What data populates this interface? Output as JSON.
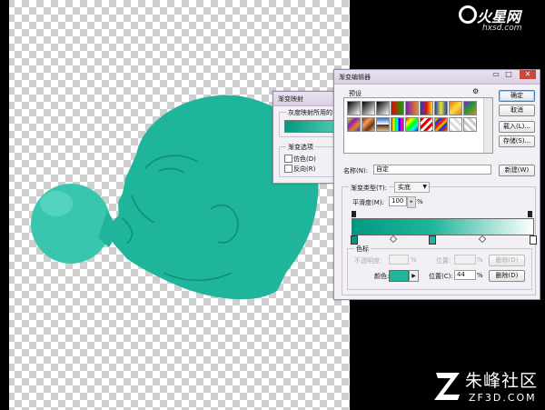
{
  "watermarks": {
    "top_brand": "火星网",
    "top_url": "hxsd.com",
    "bottom_brand": "朱峰社区",
    "bottom_url": "ZF3D.COM"
  },
  "colors": {
    "teal_fill": "#1fb59a",
    "gradient_start": "#009a80",
    "gradient_end": "#ffffff"
  },
  "gradient_map_dialog": {
    "title": "渐变映射",
    "group_label": "灰度映射所用的",
    "options_label": "渐变选项",
    "dither_label": "仿色(D)",
    "reverse_label": "反向(R)"
  },
  "gradient_editor": {
    "title": "渐变编辑器",
    "presets_label": "预设",
    "ok": "确定",
    "cancel": "取消",
    "load": "载入(L)...",
    "save": "存储(S)...",
    "name_label": "名称(N):",
    "name_value": "自定",
    "new_button": "新建(W)",
    "gradient_type_label": "渐变类型(T):",
    "gradient_type_value": "实底",
    "smoothness_label": "平滑度(M):",
    "smoothness_value": "100",
    "percent": "%",
    "stops_label": "色标",
    "opacity_label": "不透明度:",
    "location_label": "位置:",
    "delete_label": "删除(D)",
    "color_label": "颜色:",
    "color_location_label": "位置(C):",
    "color_location_value": "44",
    "color_swatch": "#1fb59a",
    "gradient_stop_position": 0.44,
    "presets": [
      {
        "icon": "preset-fg-bg",
        "bg": "linear-gradient(135deg,#000,#fff)"
      },
      {
        "icon": "preset-fg-transparent",
        "bg": "linear-gradient(135deg,#000,rgba(0,0,0,0))"
      },
      {
        "icon": "preset-black-white",
        "bg": "linear-gradient(135deg,#000,#fff)"
      },
      {
        "icon": "preset-red-green",
        "bg": "linear-gradient(90deg,#e00,#0a0)"
      },
      {
        "icon": "preset-violet-orange",
        "bg": "linear-gradient(90deg,#7a1fb0,#f08a1a)"
      },
      {
        "icon": "preset-blue-red-yellow",
        "bg": "linear-gradient(90deg,#1a3fd0,#e01010,#f5e020)"
      },
      {
        "icon": "preset-blue-yellow-blue",
        "bg": "linear-gradient(90deg,#1040d0,#f4e020,#1040d0)"
      },
      {
        "icon": "preset-orange-yellow-orange",
        "bg": "linear-gradient(135deg,#f07010,#f8e040,#f07010)"
      },
      {
        "icon": "preset-violet-green-orange",
        "bg": "linear-gradient(135deg,#8020c0,#20a030,#f08020)"
      },
      {
        "icon": "preset-yellow-violet-orange-blue",
        "bg": "linear-gradient(135deg,#f0e020,#8020c0,#f08020,#2040d0)"
      },
      {
        "icon": "preset-copper",
        "bg": "linear-gradient(135deg,#703010,#f0a060,#703010,#f0c080)"
      },
      {
        "icon": "preset-chrome",
        "bg": "linear-gradient(180deg,#2a6fd0,#fff 48%,#4a3010 52%,#e0c090)"
      },
      {
        "icon": "preset-spectrum",
        "bg": "linear-gradient(90deg,#f00,#ff0,#0f0,#0ff,#00f,#f0f,#f00)"
      },
      {
        "icon": "preset-transparent-rainbow",
        "bg": "linear-gradient(135deg,#f00,#ff0,#0f0,#0ff,#00f)"
      },
      {
        "icon": "preset-transparent-stripes",
        "bg": "repeating-linear-gradient(135deg,#e00 0 3px,#fff 3px 6px)"
      },
      {
        "icon": "preset-stripes-multi",
        "bg": "repeating-linear-gradient(135deg,#f0a000 0 3px,#2040d0 3px 6px,#e02020 6px 9px)"
      },
      {
        "icon": "preset-checker-1",
        "bg": "repeating-linear-gradient(45deg,#ddd 0 3px,#fff 3px 6px)"
      },
      {
        "icon": "preset-checker-2",
        "bg": "repeating-linear-gradient(45deg,#ccc 0 3px,#fff 3px 6px)"
      }
    ]
  }
}
